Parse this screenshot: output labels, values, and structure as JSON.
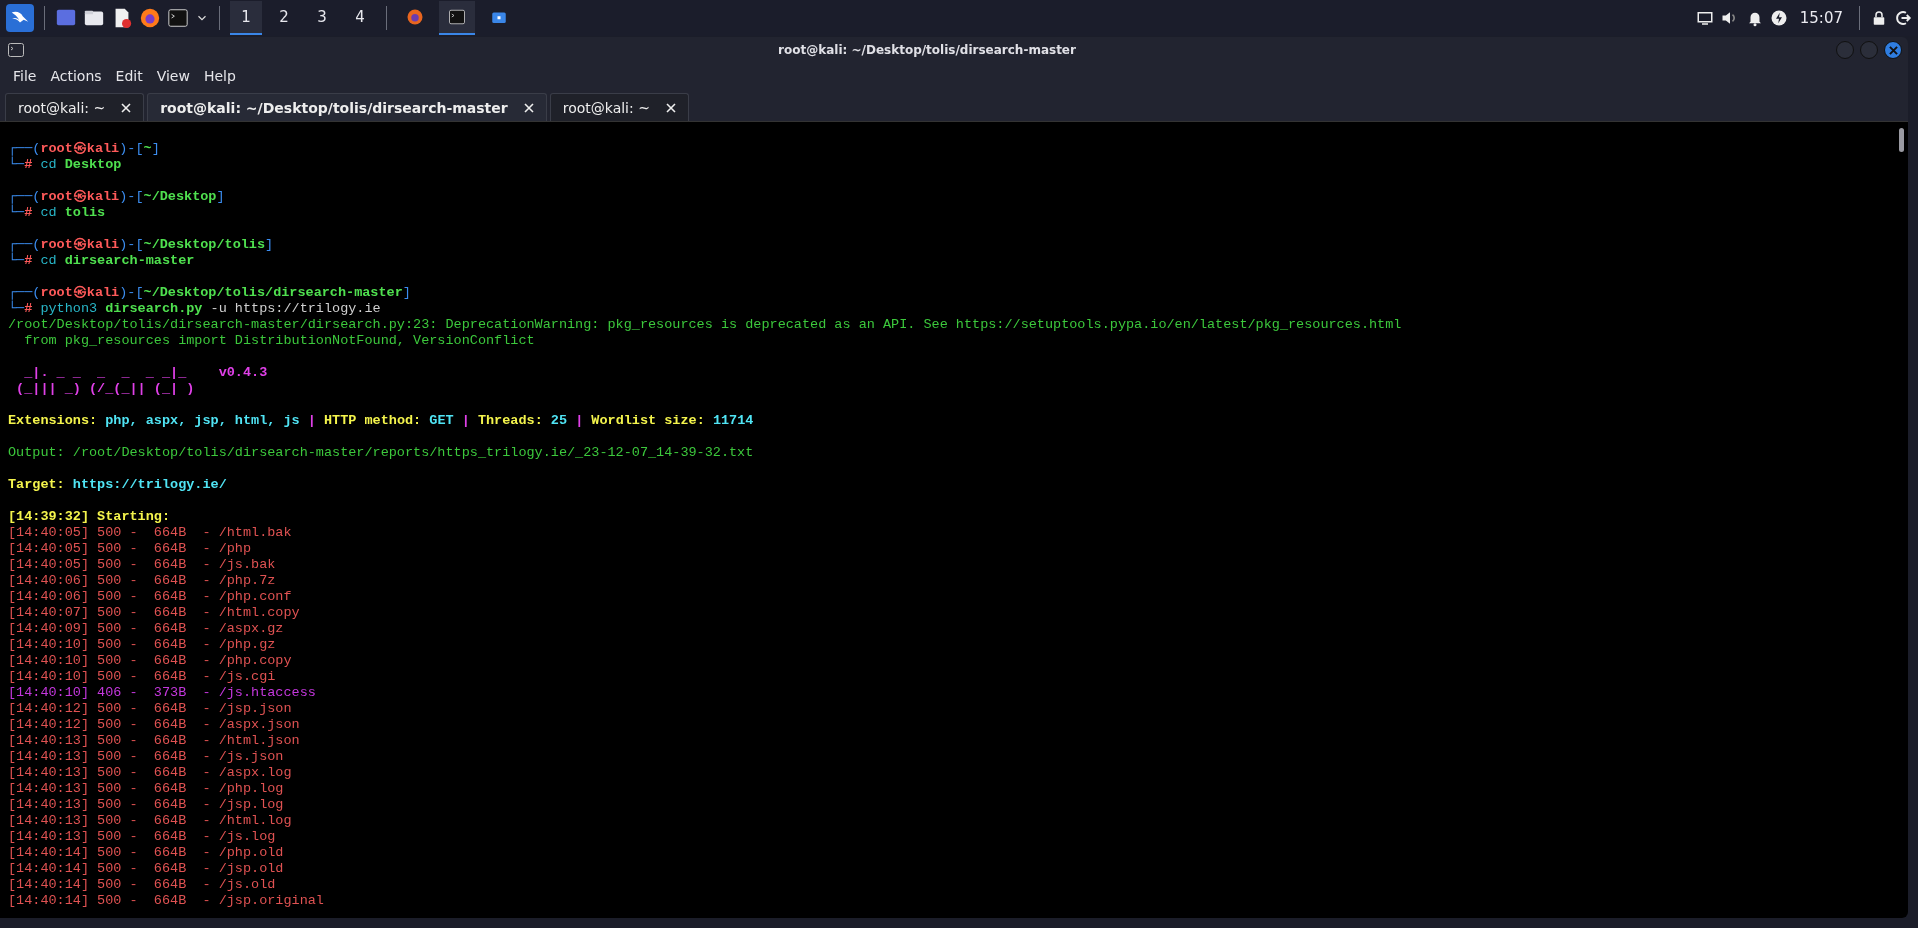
{
  "taskbar": {
    "workspaces": [
      {
        "label": "1",
        "selected": true
      },
      {
        "label": "2",
        "selected": false
      },
      {
        "label": "3",
        "selected": false
      },
      {
        "label": "4",
        "selected": false
      }
    ],
    "clock": "15:07"
  },
  "window": {
    "title": "root@kali: ~/Desktop/tolis/dirsearch-master"
  },
  "menu": [
    "File",
    "Actions",
    "Edit",
    "View",
    "Help"
  ],
  "tabs": [
    {
      "label": "root@kali: ~",
      "selected": false
    },
    {
      "label": "root@kali: ~/Desktop/tolis/dirsearch-master",
      "selected": true
    },
    {
      "label": "root@kali: ~",
      "selected": false
    }
  ],
  "terminal": {
    "blocks": [
      [
        [
          {
            "kind": "frame",
            "text": "┌──("
          },
          {
            "kind": "user",
            "text": "root㉿kali"
          },
          {
            "kind": "frame",
            "text": ")-["
          },
          {
            "kind": "path",
            "text": "~"
          },
          {
            "kind": "frame",
            "text": "]"
          }
        ],
        [
          {
            "kind": "frame",
            "text": "└─"
          },
          {
            "kind": "user",
            "text": "# "
          },
          {
            "kind": "cmd",
            "text": "cd "
          },
          {
            "kind": "arg",
            "text": "Desktop"
          }
        ]
      ],
      [
        [
          {
            "kind": "frame",
            "text": "┌──("
          },
          {
            "kind": "user",
            "text": "root㉿kali"
          },
          {
            "kind": "frame",
            "text": ")-["
          },
          {
            "kind": "path",
            "text": "~/Desktop"
          },
          {
            "kind": "frame",
            "text": "]"
          }
        ],
        [
          {
            "kind": "frame",
            "text": "└─"
          },
          {
            "kind": "user",
            "text": "# "
          },
          {
            "kind": "cmd",
            "text": "cd "
          },
          {
            "kind": "arg",
            "text": "tolis"
          }
        ]
      ],
      [
        [
          {
            "kind": "frame",
            "text": "┌──("
          },
          {
            "kind": "user",
            "text": "root㉿kali"
          },
          {
            "kind": "frame",
            "text": ")-["
          },
          {
            "kind": "path",
            "text": "~/Desktop/tolis"
          },
          {
            "kind": "frame",
            "text": "]"
          }
        ],
        [
          {
            "kind": "frame",
            "text": "└─"
          },
          {
            "kind": "user",
            "text": "# "
          },
          {
            "kind": "cmd",
            "text": "cd "
          },
          {
            "kind": "arg",
            "text": "dirsearch-master"
          }
        ]
      ],
      [
        [
          {
            "kind": "frame",
            "text": "┌──("
          },
          {
            "kind": "user",
            "text": "root㉿kali"
          },
          {
            "kind": "frame",
            "text": ")-["
          },
          {
            "kind": "path",
            "text": "~/Desktop/tolis/dirsearch-master"
          },
          {
            "kind": "frame",
            "text": "]"
          }
        ],
        [
          {
            "kind": "frame",
            "text": "└─"
          },
          {
            "kind": "user",
            "text": "# "
          },
          {
            "kind": "cmd",
            "text": "python3 "
          },
          {
            "kind": "arg",
            "text": "dirsearch.py"
          },
          {
            "kind": "plain",
            "text": " -u https://trilogy.ie"
          }
        ],
        [
          {
            "kind": "warn",
            "text": "/root/Desktop/tolis/dirsearch-master/dirsearch.py:23: DeprecationWarning: pkg_resources is deprecated as an API. See https://setuptools.pypa.io/en/latest/pkg_resources.html"
          }
        ],
        [
          {
            "kind": "warn",
            "text": "  from pkg_resources import DistributionNotFound, VersionConflict"
          }
        ]
      ],
      [
        [
          {
            "kind": "banner",
            "text": "  _|. _ _  _  _  _ _|_    v0.4.3"
          }
        ],
        [
          {
            "kind": "banner",
            "text": " (_||| _) (/_(_|| (_| )"
          }
        ]
      ],
      [
        [
          {
            "kind": "label",
            "text": "Extensions: "
          },
          {
            "kind": "value",
            "text": "php, aspx, jsp, html, js"
          },
          {
            "kind": "sep",
            "text": " | "
          },
          {
            "kind": "label",
            "text": "HTTP method: "
          },
          {
            "kind": "value",
            "text": "GET"
          },
          {
            "kind": "sep",
            "text": " | "
          },
          {
            "kind": "label",
            "text": "Threads: "
          },
          {
            "kind": "value",
            "text": "25"
          },
          {
            "kind": "sep",
            "text": " | "
          },
          {
            "kind": "label",
            "text": "Wordlist size: "
          },
          {
            "kind": "value",
            "text": "11714"
          }
        ]
      ],
      [
        [
          {
            "kind": "warn",
            "text": "Output: /root/Desktop/tolis/dirsearch-master/reports/https_trilogy.ie/_23-12-07_14-39-32.txt"
          }
        ]
      ],
      [
        [
          {
            "kind": "label",
            "text": "Target: "
          },
          {
            "kind": "value",
            "text": "https://trilogy.ie/"
          }
        ]
      ],
      [
        [
          {
            "kind": "label",
            "text": "[14:39:32] Starting:"
          }
        ],
        [
          {
            "kind": "error",
            "text": "[14:40:05] 500 -  664B  - /html.bak"
          }
        ],
        [
          {
            "kind": "error",
            "text": "[14:40:05] 500 -  664B  - /php"
          }
        ],
        [
          {
            "kind": "error",
            "text": "[14:40:05] 500 -  664B  - /js.bak"
          }
        ],
        [
          {
            "kind": "error",
            "text": "[14:40:06] 500 -  664B  - /php.7z"
          }
        ],
        [
          {
            "kind": "error",
            "text": "[14:40:06] 500 -  664B  - /php.conf"
          }
        ],
        [
          {
            "kind": "error",
            "text": "[14:40:07] 500 -  664B  - /html.copy"
          }
        ],
        [
          {
            "kind": "error",
            "text": "[14:40:09] 500 -  664B  - /aspx.gz"
          }
        ],
        [
          {
            "kind": "error",
            "text": "[14:40:10] 500 -  664B  - /php.gz"
          }
        ],
        [
          {
            "kind": "error",
            "text": "[14:40:10] 500 -  664B  - /php.copy"
          }
        ],
        [
          {
            "kind": "error",
            "text": "[14:40:10] 500 -  664B  - /js.cgi"
          }
        ],
        [
          {
            "kind": "blocked",
            "text": "[14:40:10] 406 -  373B  - /js.htaccess"
          }
        ],
        [
          {
            "kind": "error",
            "text": "[14:40:12] 500 -  664B  - /jsp.json"
          }
        ],
        [
          {
            "kind": "error",
            "text": "[14:40:12] 500 -  664B  - /aspx.json"
          }
        ],
        [
          {
            "kind": "error",
            "text": "[14:40:13] 500 -  664B  - /html.json"
          }
        ],
        [
          {
            "kind": "error",
            "text": "[14:40:13] 500 -  664B  - /js.json"
          }
        ],
        [
          {
            "kind": "error",
            "text": "[14:40:13] 500 -  664B  - /aspx.log"
          }
        ],
        [
          {
            "kind": "error",
            "text": "[14:40:13] 500 -  664B  - /php.log"
          }
        ],
        [
          {
            "kind": "error",
            "text": "[14:40:13] 500 -  664B  - /jsp.log"
          }
        ],
        [
          {
            "kind": "error",
            "text": "[14:40:13] 500 -  664B  - /html.log"
          }
        ],
        [
          {
            "kind": "error",
            "text": "[14:40:13] 500 -  664B  - /js.log"
          }
        ],
        [
          {
            "kind": "error",
            "text": "[14:40:14] 500 -  664B  - /php.old"
          }
        ],
        [
          {
            "kind": "error",
            "text": "[14:40:14] 500 -  664B  - /jsp.old"
          }
        ],
        [
          {
            "kind": "error",
            "text": "[14:40:14] 500 -  664B  - /js.old"
          }
        ],
        [
          {
            "kind": "error",
            "text": "[14:40:14] 500 -  664B  - /jsp.original"
          }
        ]
      ]
    ]
  }
}
